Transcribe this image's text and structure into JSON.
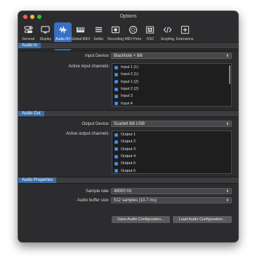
{
  "window": {
    "title": "Options"
  },
  "colors": {
    "accent": "#3a6fc2",
    "section_tab": "#3b6ea5",
    "checkbox": "#3b7ae0"
  },
  "toolbar": {
    "items": [
      {
        "label": "General",
        "icon": "toggle-icon"
      },
      {
        "label": "Display",
        "icon": "monitor-icon"
      },
      {
        "label": "Audio I/O",
        "icon": "waveform-icon",
        "active": true
      },
      {
        "label": "Global MIDI",
        "icon": "piano-icon"
      },
      {
        "label": "Setlist",
        "icon": "list-icon"
      },
      {
        "label": "Recording",
        "icon": "record-icon"
      },
      {
        "label": "MIDI Ports",
        "icon": "midi-port-icon"
      },
      {
        "label": "OSC",
        "icon": "osc-icon"
      },
      {
        "label": "Scripting",
        "icon": "code-icon"
      },
      {
        "label": "Extensions",
        "icon": "plus-icon"
      }
    ]
  },
  "audio_in": {
    "section_title": "Audio In",
    "input_device_label": "Input Device:",
    "input_device_value": "Blackhole + 8i6",
    "active_inputs_label": "Active input channels:",
    "channels": [
      "Input 1 (1)",
      "Input 2 (1)",
      "Input 1 (2)",
      "Input 2 (2)",
      "Input 3",
      "Input 4"
    ]
  },
  "audio_out": {
    "section_title": "Audio Out",
    "output_device_label": "Output Device:",
    "output_device_value": "Scarlett 8i6 USB",
    "active_outputs_label": "Active output channels:",
    "channels": [
      "Output 1",
      "Output 2",
      "Output 3",
      "Output 4",
      "Output 5",
      "Output 6"
    ]
  },
  "audio_properties": {
    "section_title": "Audio Properties",
    "sample_rate_label": "Sample rate:",
    "sample_rate_value": "48000 Hz",
    "buffer_size_label": "Audio buffer size:",
    "buffer_size_value": "512 samples (10.7 ms)"
  },
  "buttons": {
    "save_config": "Save Audio Configuration...",
    "load_config": "Load Audio Configuration..."
  }
}
